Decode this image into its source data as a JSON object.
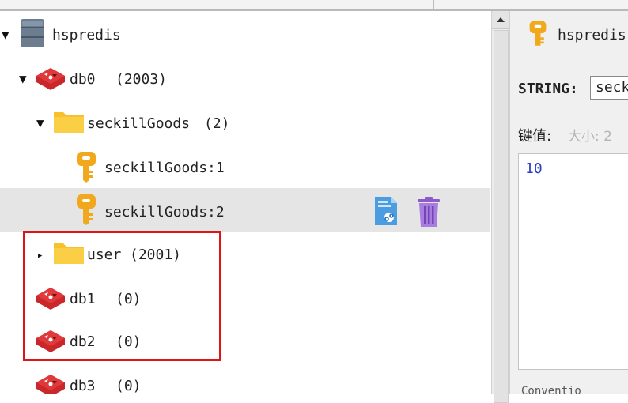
{
  "colors": {
    "accent_red": "#e01414",
    "selected_row": "#e5e5e5",
    "folder": "#f8c12b",
    "key": "#f2a81c",
    "value_text": "#2a3fbf"
  },
  "tree": {
    "connection": {
      "label": "hspredis",
      "icon": "server-icon",
      "expanded": true
    },
    "db0": {
      "label": "db0",
      "count": "(2003)",
      "icon": "redis-icon",
      "expanded": true
    },
    "seckill_folder": {
      "label": "seckillGoods",
      "count": "(2)",
      "icon": "folder-icon",
      "expanded": true
    },
    "keys": [
      {
        "label": "seckillGoods:1",
        "icon": "key-icon",
        "selected": false
      },
      {
        "label": "seckillGoods:2",
        "icon": "key-icon",
        "selected": true,
        "actions": [
          "copy-document-icon",
          "trash-icon"
        ]
      }
    ],
    "user_folder": {
      "label": "user",
      "count": "(2001)",
      "icon": "folder-icon",
      "expanded": false
    },
    "databases": [
      {
        "label": "db1",
        "count": "(0)",
        "icon": "redis-icon"
      },
      {
        "label": "db2",
        "count": "(0)",
        "icon": "redis-icon"
      },
      {
        "label": "db3",
        "count": "(0)",
        "icon": "redis-icon"
      }
    ]
  },
  "right_panel": {
    "title": "hspredis",
    "type_label": "STRING:",
    "key_input_value": "seck",
    "value_label": "键值:",
    "size_label": "大小: 2",
    "value_text": "10",
    "bottom_label": "Conventio"
  }
}
